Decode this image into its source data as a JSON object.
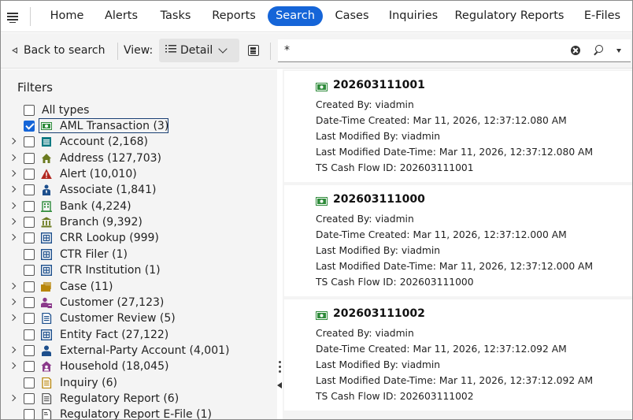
{
  "nav": {
    "items": [
      {
        "label": "Home",
        "active": false
      },
      {
        "label": "Alerts",
        "active": false
      },
      {
        "label": "Tasks",
        "active": false
      },
      {
        "label": "Reports",
        "active": false
      },
      {
        "label": "Search",
        "active": true
      },
      {
        "label": "Cases",
        "active": false
      },
      {
        "label": "Inquiries",
        "active": false
      },
      {
        "label": "Regulatory Reports",
        "active": false
      },
      {
        "label": "E-Files",
        "active": false
      }
    ]
  },
  "toolbar": {
    "back_label": "Back to search",
    "view_label": "View:",
    "view_value": "Detail",
    "search_value": "*"
  },
  "filters": {
    "title": "Filters",
    "all_types_label": "All types",
    "items": [
      {
        "label": "AML Transaction (3)",
        "checked": true,
        "expandable": false,
        "icon": "cash-icon"
      },
      {
        "label": "Account (2,168)",
        "checked": false,
        "expandable": true,
        "icon": "account-icon"
      },
      {
        "label": "Address (127,703)",
        "checked": false,
        "expandable": true,
        "icon": "house-icon"
      },
      {
        "label": "Alert (10,010)",
        "checked": false,
        "expandable": true,
        "icon": "warning-icon"
      },
      {
        "label": "Associate (1,841)",
        "checked": false,
        "expandable": true,
        "icon": "associate-icon"
      },
      {
        "label": "Bank (4,224)",
        "checked": false,
        "expandable": true,
        "icon": "bank-building-icon"
      },
      {
        "label": "Branch (9,392)",
        "checked": false,
        "expandable": true,
        "icon": "branch-icon"
      },
      {
        "label": "CRR Lookup (999)",
        "checked": false,
        "expandable": true,
        "icon": "grid-icon"
      },
      {
        "label": "CTR Filer (1)",
        "checked": false,
        "expandable": false,
        "icon": "grid-icon"
      },
      {
        "label": "CTR Institution (1)",
        "checked": false,
        "expandable": false,
        "icon": "grid-icon"
      },
      {
        "label": "Case (11)",
        "checked": false,
        "expandable": true,
        "icon": "folder-icon"
      },
      {
        "label": "Customer (27,123)",
        "checked": false,
        "expandable": true,
        "icon": "customer-icon"
      },
      {
        "label": "Customer Review (5)",
        "checked": false,
        "expandable": true,
        "icon": "review-doc-icon"
      },
      {
        "label": "Entity Fact (27,122)",
        "checked": false,
        "expandable": false,
        "icon": "grid-icon"
      },
      {
        "label": "External-Party Account (4,001)",
        "checked": false,
        "expandable": true,
        "icon": "person-icon"
      },
      {
        "label": "Household (18,045)",
        "checked": false,
        "expandable": true,
        "icon": "household-icon"
      },
      {
        "label": "Inquiry (6)",
        "checked": false,
        "expandable": false,
        "icon": "inquiry-doc-icon"
      },
      {
        "label": "Regulatory Report (6)",
        "checked": false,
        "expandable": true,
        "icon": "report-doc-icon"
      },
      {
        "label": "Regulatory Report E-File (1)",
        "checked": false,
        "expandable": false,
        "icon": "efile-doc-icon"
      }
    ]
  },
  "results": {
    "labels": {
      "created_by": "Created By:",
      "created": "Date-Time Created:",
      "modified_by": "Last Modified By:",
      "modified": "Last Modified Date-Time:",
      "ts_id": "TS Cash Flow ID:"
    },
    "cards": [
      {
        "title": "202603111001",
        "created_by": "viadmin",
        "created": "Mar 11, 2026, 12:37:12.080 AM",
        "modified_by": "viadmin",
        "modified": "Mar 11, 2026, 12:37:12.080 AM",
        "ts_id": "202603111001"
      },
      {
        "title": "202603111000",
        "created_by": "viadmin",
        "created": "Mar 11, 2026, 12:37:12.000 AM",
        "modified_by": "viadmin",
        "modified": "Mar 11, 2026, 12:37:12.000 AM",
        "ts_id": "202603111000"
      },
      {
        "title": "202603111002",
        "created_by": "viadmin",
        "created": "Mar 11, 2026, 12:37:12.092 AM",
        "modified_by": "viadmin",
        "modified": "Mar 11, 2026, 12:37:12.092 AM",
        "ts_id": "202603111002"
      }
    ]
  },
  "colors": {
    "accent": "#1565d8",
    "cash_green": "#2e8b3a",
    "teal": "#0f7a83",
    "olive": "#6a7a1f",
    "alert_red": "#b2271f",
    "navy": "#1d4f8c",
    "gold": "#b8860b",
    "purple": "#8b3a8b"
  }
}
